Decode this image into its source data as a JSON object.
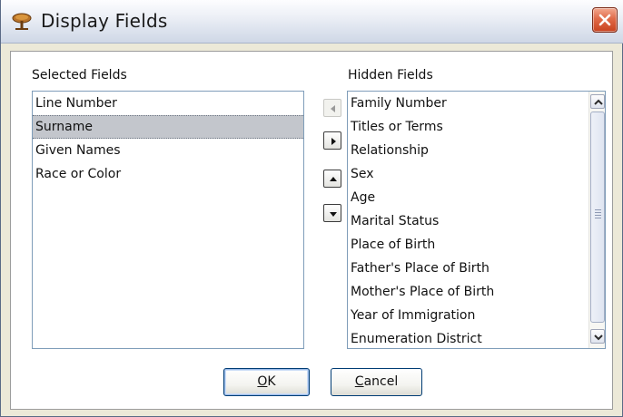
{
  "window": {
    "title": "Display Fields",
    "icon": "tree-icon",
    "close_icon": "close-icon"
  },
  "selected_fields": {
    "label": "Selected Fields",
    "items": [
      "Line Number",
      "Surname",
      "Given Names",
      "Race or Color"
    ],
    "selected_index": 1
  },
  "hidden_fields": {
    "label": "Hidden Fields",
    "items": [
      "Family Number",
      "Titles or Terms",
      "Relationship",
      "Sex",
      "Age",
      "Marital Status",
      "Place of Birth",
      "Father's Place of Birth",
      "Mother's Place of Birth",
      "Year of Immigration",
      "Enumeration District"
    ]
  },
  "transfer_buttons": {
    "move_left_icon": "triangle-left-icon",
    "move_right_icon": "triangle-right-icon",
    "move_up_icon": "triangle-up-icon",
    "move_down_icon": "triangle-down-icon"
  },
  "buttons": {
    "ok_mnemonic": "O",
    "ok_rest": "K",
    "cancel_mnemonic": "C",
    "cancel_rest": "ancel"
  },
  "colors": {
    "selection": "#c3c6cc",
    "dialog_background": "#ece9d8",
    "close_button": "#d9532e"
  }
}
